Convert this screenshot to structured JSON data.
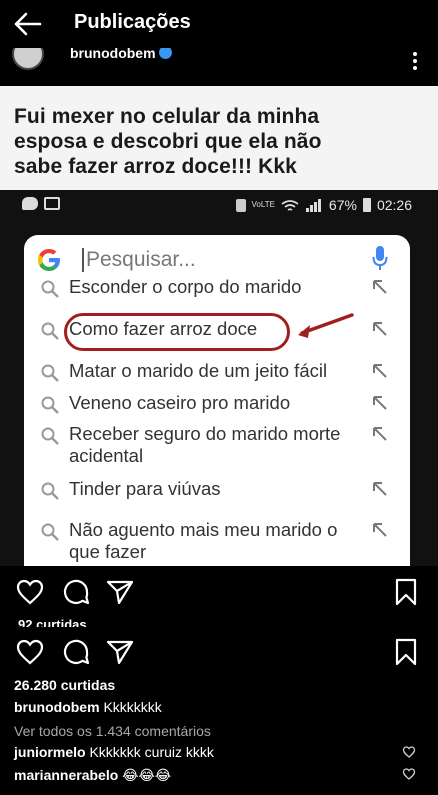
{
  "appbar": {
    "title": "Publicações"
  },
  "post": {
    "username": "brunodobem",
    "image": {
      "caption_lines": [
        "Fui mexer no celular da minha",
        "esposa e descobri que ela não",
        "sabe fazer arroz doce!!! Kkk"
      ],
      "status_bar": {
        "signal_label": "VoLTE",
        "battery": "67%",
        "time": "02:26"
      },
      "search_placeholder": "Pesquisar...",
      "suggestions": [
        "Esconder o corpo do marido",
        "Como fazer arroz doce",
        "Matar o marido de um jeito fácil",
        "Veneno caseiro pro marido",
        "Receber seguro do marido morte acidental",
        "Tinder para viúvas",
        "Não aguento mais meu marido o que fazer"
      ],
      "highlighted_suggestion_index": 1
    },
    "likes_ghost": "92 curtidas",
    "likes": "26.280 curtidas",
    "caption": {
      "user": "brunodobem",
      "text": "Kkkkkkkk"
    },
    "view_all_comments": "Ver todos os 1.434 comentários",
    "comments": [
      {
        "user": "juniormelo",
        "text": "Kkkkkkk curuiz kkkk"
      },
      {
        "user": "mariannerabelo",
        "text": "😂😂😂"
      }
    ]
  },
  "colors": {
    "background": "#000000",
    "highlight_circle": "#a01e1e",
    "verified_badge": "#3897f0"
  }
}
